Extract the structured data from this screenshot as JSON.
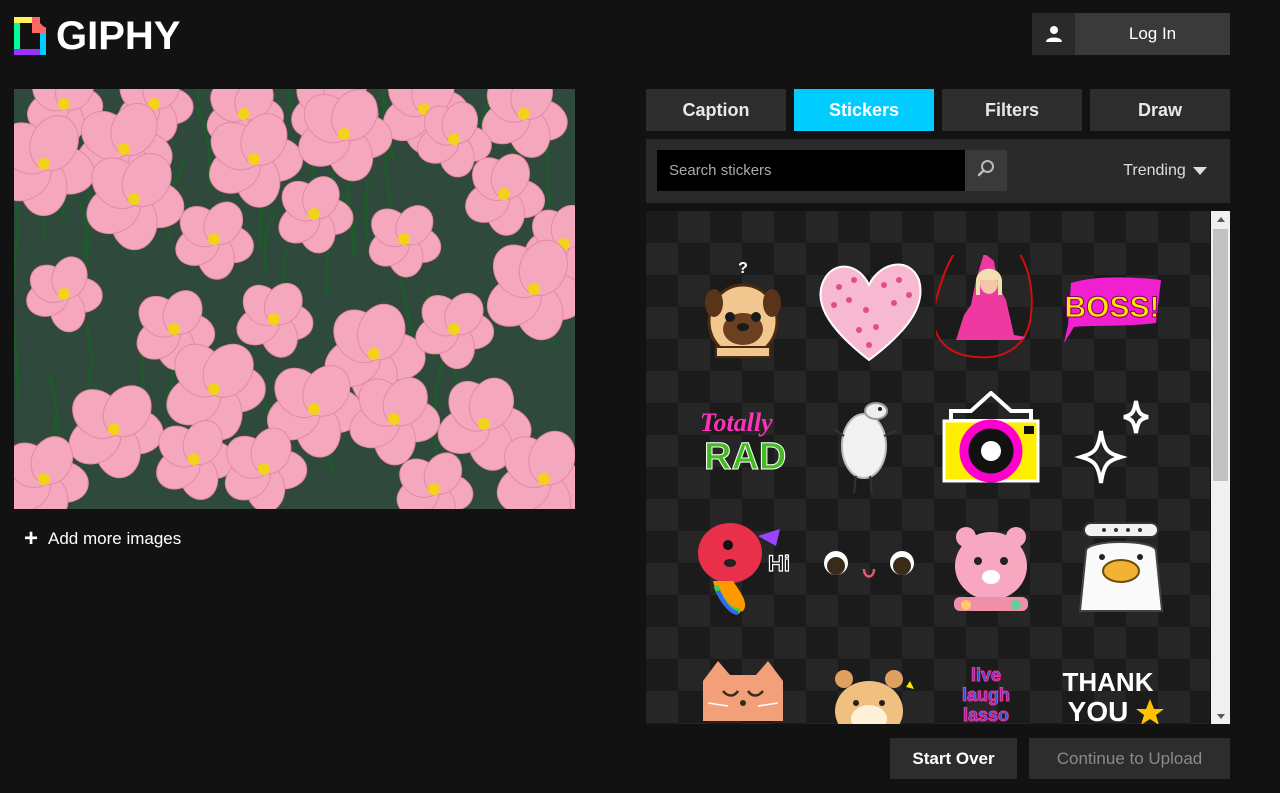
{
  "header": {
    "logo_text": "GIPHY",
    "login_label": "Log In"
  },
  "preview": {
    "add_more_label": "Add more images"
  },
  "tabs": [
    {
      "label": "Caption",
      "active": false
    },
    {
      "label": "Stickers",
      "active": true
    },
    {
      "label": "Filters",
      "active": false
    },
    {
      "label": "Draw",
      "active": false
    }
  ],
  "search": {
    "placeholder": "Search stickers",
    "sort_label": "Trending"
  },
  "stickers": {
    "items": [
      {
        "name": "pug"
      },
      {
        "name": "pink-heart"
      },
      {
        "name": "pink-queen"
      },
      {
        "name": "boss",
        "text": "BOSS!"
      },
      {
        "name": "totally-rad",
        "text_top": "Totally",
        "text_bottom": "RAD"
      },
      {
        "name": "sheep"
      },
      {
        "name": "camera"
      },
      {
        "name": "sparkles"
      },
      {
        "name": "hi-fish",
        "text": "Hi"
      },
      {
        "name": "cute-eyes"
      },
      {
        "name": "pink-bear"
      },
      {
        "name": "duck"
      },
      {
        "name": "cat"
      },
      {
        "name": "hamster"
      },
      {
        "name": "live-laugh-lasso",
        "lines": [
          "live",
          "laugh",
          "lasso"
        ]
      },
      {
        "name": "thank-you",
        "text_top": "THANK",
        "text_bottom": "YOU"
      }
    ]
  },
  "footer": {
    "start_over_label": "Start Over",
    "continue_label": "Continue to Upload"
  },
  "colors": {
    "accent": "#00ccff",
    "background": "#121212",
    "panel": "#2d2d2d"
  }
}
